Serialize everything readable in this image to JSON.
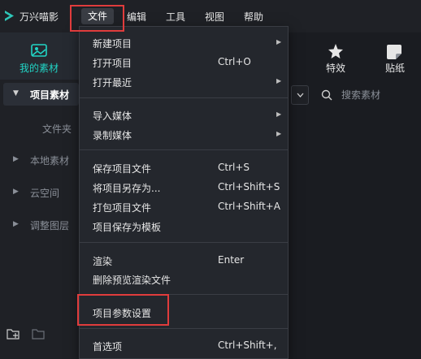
{
  "app": {
    "name": "万兴喵影"
  },
  "menubar": {
    "items": [
      "文件",
      "编辑",
      "工具",
      "视图",
      "帮助"
    ]
  },
  "left_panel": {
    "media_tab_label": "我的素材",
    "project_media": "项目素材",
    "folder": "文件夹",
    "local_media": "本地素材",
    "cloud": "云空间",
    "adjustment_layer": "调整图层"
  },
  "toolbar": {
    "effects_label": "特效",
    "stickers_label": "贴纸"
  },
  "search": {
    "placeholder": "搜索素材"
  },
  "file_menu": {
    "items": [
      {
        "label": "新建项目",
        "shortcut": ""
      },
      {
        "label": "打开项目",
        "shortcut": "Ctrl+O"
      },
      {
        "label": "打开最近",
        "shortcut": ""
      },
      {
        "label": "导入媒体",
        "shortcut": ""
      },
      {
        "label": "录制媒体",
        "shortcut": ""
      },
      {
        "label": "保存项目文件",
        "shortcut": "Ctrl+S"
      },
      {
        "label": "将项目另存为...",
        "shortcut": "Ctrl+Shift+S"
      },
      {
        "label": "打包项目文件",
        "shortcut": "Ctrl+Shift+A"
      },
      {
        "label": "项目保存为模板",
        "shortcut": ""
      },
      {
        "label": "渲染",
        "shortcut": "Enter"
      },
      {
        "label": "删除预览渲染文件",
        "shortcut": ""
      },
      {
        "label": "项目参数设置",
        "shortcut": ""
      },
      {
        "label": "首选项",
        "shortcut": "Ctrl+Shift+,"
      }
    ]
  },
  "colors": {
    "accent": "#21d4c5",
    "highlight_border": "#e03c3c",
    "menu_bg": "#24272d"
  }
}
